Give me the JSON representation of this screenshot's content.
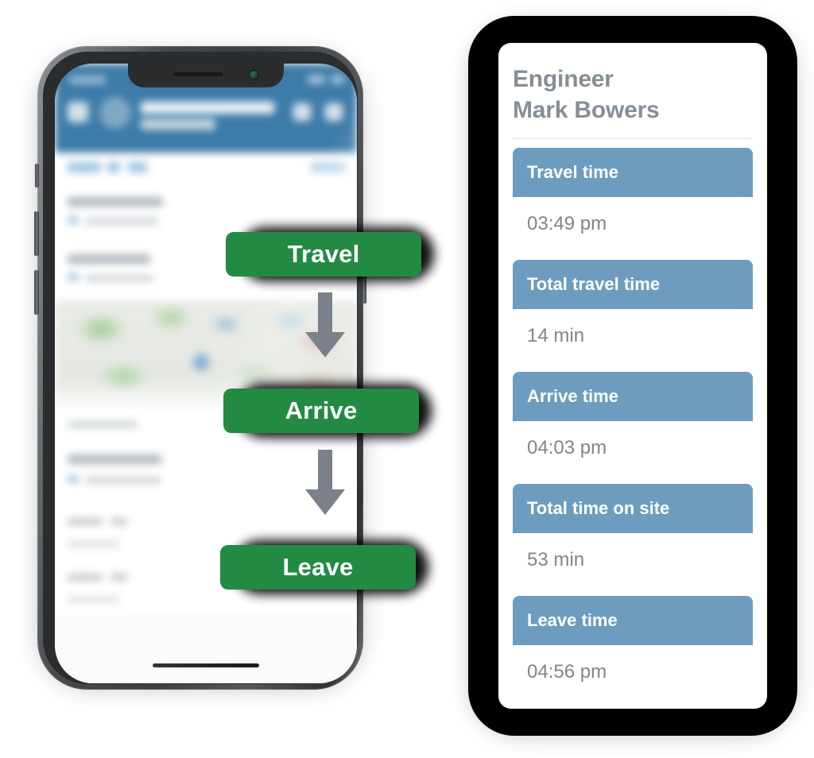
{
  "phone_mockup": {
    "name": "blurred-mobile-app-screenshot",
    "status_bar_icons": [
      "signal-icon",
      "wifi-icon",
      "battery-icon"
    ],
    "header_icons": [
      "menu-icon",
      "avatar",
      "search-icon",
      "more-icon"
    ],
    "home_indicator": "home-indicator"
  },
  "callouts": [
    {
      "id": "travel",
      "label": "Travel"
    },
    {
      "id": "arrive",
      "label": "Arrive"
    },
    {
      "id": "leave",
      "label": "Leave"
    }
  ],
  "arrows": [
    {
      "id": "arrow-travel-to-arrive",
      "icon": "arrow-down-icon"
    },
    {
      "id": "arrow-arrive-to-leave",
      "icon": "arrow-down-icon"
    }
  ],
  "detail_panel": {
    "role_label": "Engineer",
    "engineer_name": "Mark Bowers",
    "metrics": [
      {
        "label": "Travel time",
        "value": "03:49 pm"
      },
      {
        "label": "Total travel time",
        "value": "14 min"
      },
      {
        "label": "Arrive time",
        "value": "04:03 pm"
      },
      {
        "label": "Total time on site",
        "value": "53 min"
      },
      {
        "label": "Leave time",
        "value": "04:56 pm"
      }
    ]
  },
  "colors": {
    "green_badge": "#238a43",
    "blue_metric": "#6d9cbe",
    "heading_gray": "#868e96",
    "value_gray": "#7d858c",
    "arrow_gray": "#7a8189",
    "app_header_blue": "#3d7ba8",
    "frame_black": "#000000"
  }
}
